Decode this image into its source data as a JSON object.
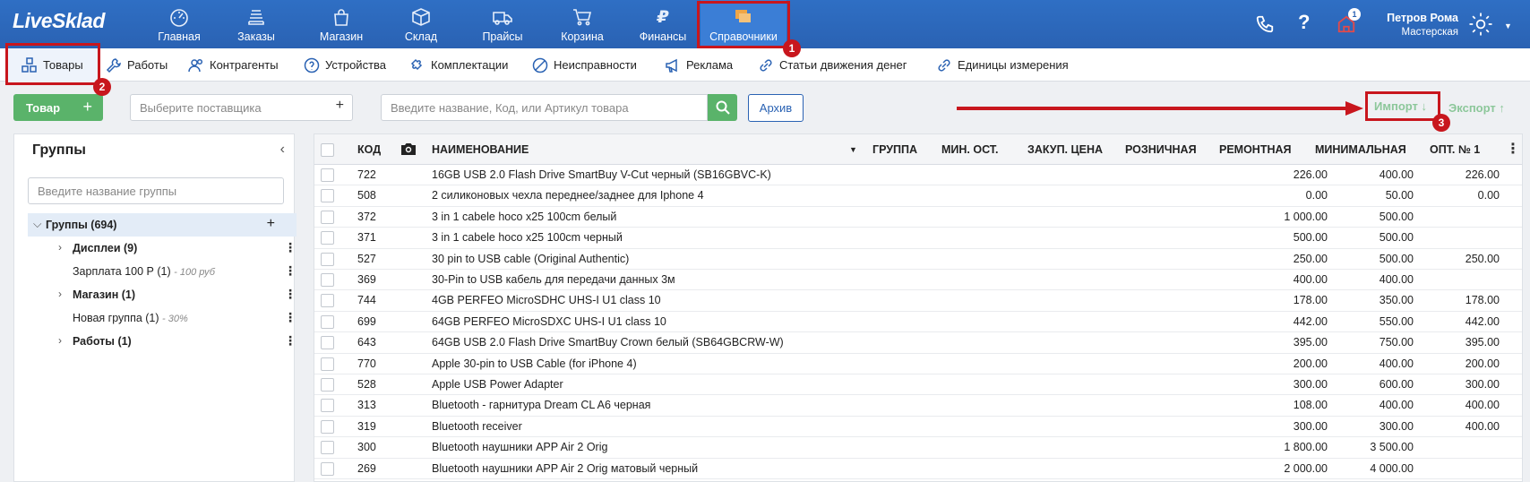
{
  "app": {
    "logo": "LiveSklad"
  },
  "topnav": [
    {
      "label": "Главная",
      "icon": "dashboard-icon"
    },
    {
      "label": "Заказы",
      "icon": "stack-icon"
    },
    {
      "label": "Магазин",
      "icon": "shop-bag-icon"
    },
    {
      "label": "Склад",
      "icon": "box-icon"
    },
    {
      "label": "Прайсы",
      "icon": "truck-icon"
    },
    {
      "label": "Корзина",
      "icon": "cart-icon"
    },
    {
      "label": "Финансы",
      "icon": "ruble-icon"
    },
    {
      "label": "Справочники",
      "icon": "folders-icon"
    }
  ],
  "user": {
    "name": "Петров Рома",
    "role": "Мастерская",
    "notifications": "1"
  },
  "subnav": [
    {
      "label": "Товары"
    },
    {
      "label": "Работы"
    },
    {
      "label": "Контрагенты"
    },
    {
      "label": "Устройства"
    },
    {
      "label": "Комплектации"
    },
    {
      "label": "Неисправности"
    },
    {
      "label": "Реклама"
    },
    {
      "label": "Статьи движения денег"
    },
    {
      "label": "Единицы измерения"
    }
  ],
  "toolbar": {
    "add_label": "Товар",
    "supplier_placeholder": "Выберите поставщика",
    "search_placeholder": "Введите название, Код, или Артикул товара",
    "archive_label": "Архив",
    "import_label": "Импорт ↓",
    "export_label": "Экспорт ↑"
  },
  "groups": {
    "title": "Группы",
    "search_placeholder": "Введите название группы",
    "root": "Группы (694)",
    "items": [
      {
        "label": "Дисплеи (9)",
        "note": "",
        "bold": true,
        "expandable": true
      },
      {
        "label": "Зарплата 100 Р (1)",
        "note": "- 100 руб",
        "bold": false,
        "expandable": false
      },
      {
        "label": "Магазин (1)",
        "note": "",
        "bold": true,
        "expandable": true
      },
      {
        "label": "Новая группа (1)",
        "note": "- 30%",
        "bold": false,
        "expandable": false
      },
      {
        "label": "Работы (1)",
        "note": "",
        "bold": true,
        "expandable": true
      }
    ]
  },
  "table": {
    "columns": [
      "КОД",
      "НАИМЕНОВАНИЕ",
      "ГРУППА",
      "МИН. ОСТ.",
      "ЗАКУП. ЦЕНА",
      "РОЗНИЧНАЯ",
      "РЕМОНТНАЯ",
      "МИНИМАЛЬНАЯ",
      "ОПТ. № 1"
    ],
    "rows": [
      {
        "code": "722",
        "name": "16GB USB 2.0 Flash Drive SmartBuy V-Cut черный (SB16GBVC-K)",
        "purchase": "226.00",
        "retail": "400.00",
        "repair": "226.00"
      },
      {
        "code": "508",
        "name": "2 силиконовых чехла переднее/заднее для Iphone 4",
        "purchase": "0.00",
        "retail": "50.00",
        "repair": "0.00"
      },
      {
        "code": "372",
        "name": "3 in 1 cabele hoco x25 100cm белый",
        "purchase": "1 000.00",
        "retail": "500.00",
        "repair": ""
      },
      {
        "code": "371",
        "name": "3 in 1 cabele hoco x25 100cm черный",
        "purchase": "500.00",
        "retail": "500.00",
        "repair": ""
      },
      {
        "code": "527",
        "name": "30 pin to USB cable (Original Authentic)",
        "purchase": "250.00",
        "retail": "500.00",
        "repair": "250.00"
      },
      {
        "code": "369",
        "name": "30-Pin to USB кабель для передачи данных 3м",
        "purchase": "400.00",
        "retail": "400.00",
        "repair": ""
      },
      {
        "code": "744",
        "name": "4GB PERFEO MicroSDHC UHS-I U1 class 10",
        "purchase": "178.00",
        "retail": "350.00",
        "repair": "178.00"
      },
      {
        "code": "699",
        "name": "64GB PERFEO MicroSDXC UHS-I U1 class 10",
        "purchase": "442.00",
        "retail": "550.00",
        "repair": "442.00"
      },
      {
        "code": "643",
        "name": "64GB USB 2.0 Flash Drive SmartBuy Crown белый (SB64GBCRW-W)",
        "purchase": "395.00",
        "retail": "750.00",
        "repair": "395.00"
      },
      {
        "code": "770",
        "name": "Apple 30-pin to USB Cable (for iPhone 4)",
        "purchase": "200.00",
        "retail": "400.00",
        "repair": "200.00"
      },
      {
        "code": "528",
        "name": "Apple USB Power Adapter",
        "purchase": "300.00",
        "retail": "600.00",
        "repair": "300.00"
      },
      {
        "code": "313",
        "name": "Bluetooth - гарнитура Dream CL A6 черная",
        "purchase": "108.00",
        "retail": "400.00",
        "repair": "400.00"
      },
      {
        "code": "319",
        "name": "Bluetooth receiver",
        "purchase": "300.00",
        "retail": "300.00",
        "repair": "400.00"
      },
      {
        "code": "300",
        "name": "Bluetooth наушники APP Air 2 Orig",
        "purchase": "1 800.00",
        "retail": "3 500.00",
        "repair": ""
      },
      {
        "code": "269",
        "name": "Bluetooth наушники APP Air 2 Orig матовый черный",
        "purchase": "2 000.00",
        "retail": "4 000.00",
        "repair": ""
      }
    ]
  },
  "annotations": [
    "1",
    "2",
    "3"
  ],
  "colors": {
    "brand": "#2a62b3",
    "accent_green": "#5ab36a",
    "annotation_red": "#c8161d"
  }
}
